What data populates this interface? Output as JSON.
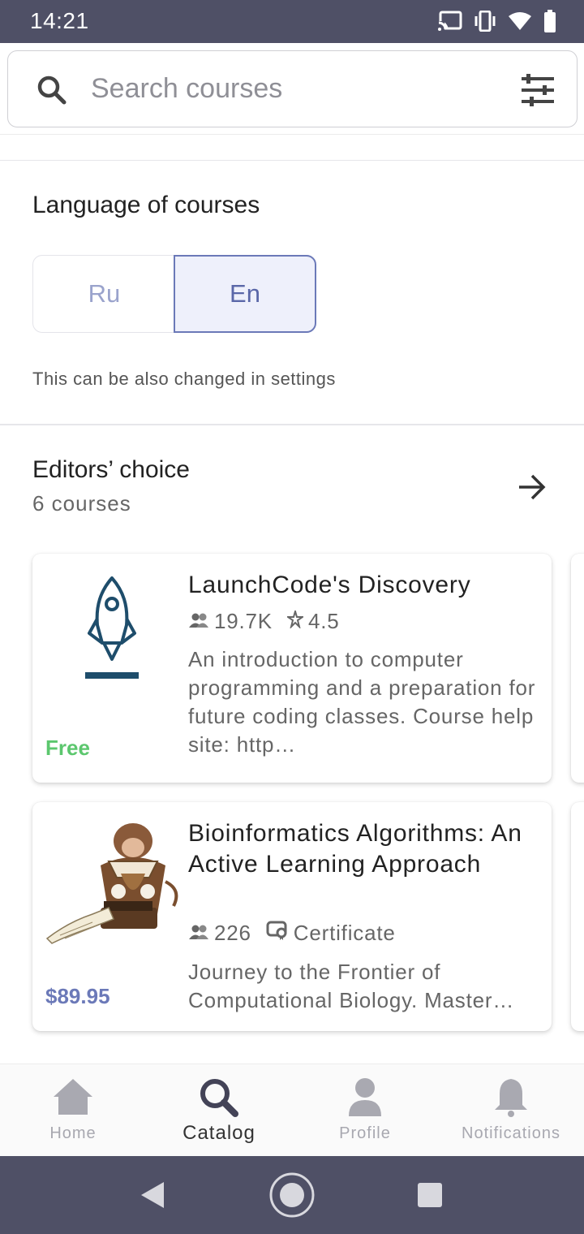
{
  "status_bar": {
    "time": "14:21",
    "icons": [
      "cast-icon",
      "vibrate-icon",
      "wifi-icon",
      "battery-icon"
    ]
  },
  "search": {
    "placeholder": "Search courses",
    "value": ""
  },
  "language": {
    "title": "Language of courses",
    "options": [
      "Ru",
      "En"
    ],
    "selected": "En",
    "hint": "This can be also changed in settings"
  },
  "editors_choice": {
    "title": "Editors’ choice",
    "count": "6 courses"
  },
  "courses": [
    {
      "title": "LaunchCode's Discovery",
      "learners": "19.7K",
      "rating": "4.5",
      "description": "An introduction to computer programming and a preparation for future coding classes. Course help site: http…",
      "price": "Free",
      "image": "rocket-logo"
    },
    {
      "title": "Bioinformatics Algorithms: An Active Learning Approach",
      "learners": "226",
      "certificate": "Certificate",
      "description": "Journey to the Frontier of Computational Biology. Master…",
      "price": "$89.95",
      "image": "monkey-typewriter-illustration"
    }
  ],
  "bottom_nav": {
    "items": [
      {
        "label": "Home",
        "icon": "home-icon"
      },
      {
        "label": "Catalog",
        "icon": "search-icon"
      },
      {
        "label": "Profile",
        "icon": "profile-icon"
      },
      {
        "label": "Notifications",
        "icon": "bell-icon"
      }
    ],
    "active": "Catalog"
  },
  "colors": {
    "status_bar": "#4f5066",
    "accent": "#6b79b8",
    "free_price": "#5cc76e",
    "paid_price": "#6b79b8"
  }
}
